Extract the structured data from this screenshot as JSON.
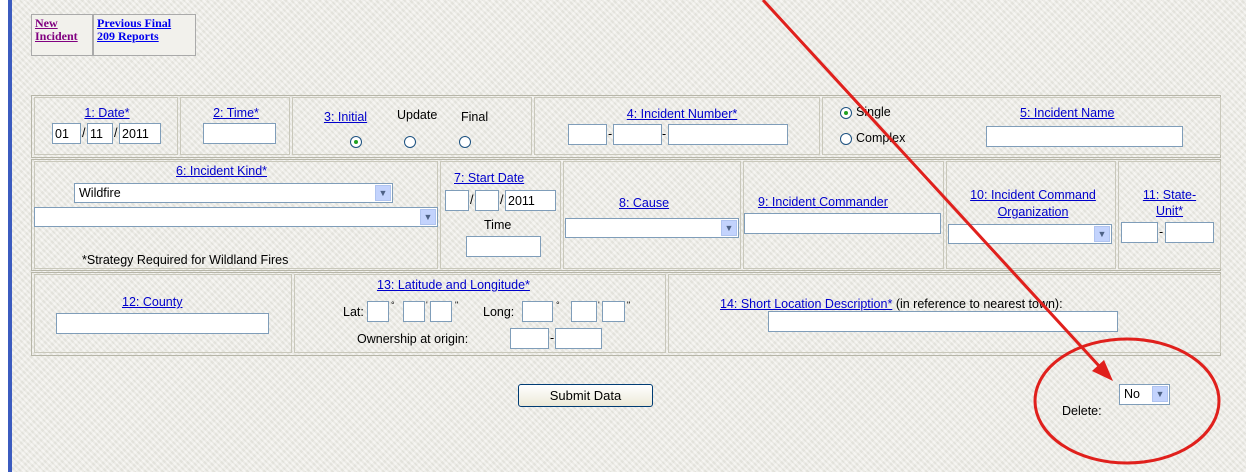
{
  "nav": {
    "new_incident": "New Incident",
    "previous_final": "Previous Final",
    "reports_209": "209 Reports"
  },
  "row1": {
    "date_label": "1: Date*",
    "date": {
      "month": "01",
      "day": "11",
      "year": "2011"
    },
    "time_label": "2: Time*",
    "time_value": "",
    "report_type_label": "3: Initial",
    "report_types": [
      "Update",
      "Final"
    ],
    "report_type_selected": "Initial",
    "incident_number_label": "4: Incident Number*",
    "incident_number_parts": [
      "",
      "",
      ""
    ],
    "single_label": "Single",
    "complex_label": "Complex",
    "single_complex_selected": "Single",
    "incident_name_label": "5: Incident Name",
    "incident_name_value": ""
  },
  "row2": {
    "incident_kind_label": "6: Incident Kind*",
    "incident_kind_value": "Wildfire",
    "strategy_value": "",
    "strategy_note": "*Strategy Required for Wildland Fires",
    "start_date_label": "7: Start Date",
    "start_date": {
      "month": "",
      "day": "",
      "year": "2011"
    },
    "time_label": "Time",
    "start_time_value": "",
    "cause_label": "8: Cause",
    "cause_value": "",
    "commander_label": "9: Incident Commander",
    "commander_value": "",
    "ico_label_line1": "10: Incident Command",
    "ico_label_line2": "Organization",
    "ico_value": "",
    "state_unit_label_line1": "11: State-",
    "state_unit_label_line2": "Unit*",
    "state_value": "",
    "unit_value": ""
  },
  "row3": {
    "county_label": "12: County",
    "county_value": "",
    "latlong_label": "13: Latitude and Longitude*",
    "lat_label": "Lat:",
    "long_label": "Long:",
    "deg_symbol": "°",
    "min_symbol": "'",
    "sec_symbol": "\"",
    "ownership_label": "Ownership at origin:",
    "location_label": "14: Short Location Description*",
    "location_note": "(in reference to nearest town):",
    "location_value": ""
  },
  "footer": {
    "submit_label": "Submit Data",
    "delete_label": "Delete:",
    "delete_value": "No"
  },
  "colors": {
    "link": "#0000cc",
    "annotation": "#e0201c",
    "background": "#ecebe4"
  },
  "icons": {
    "dropdown": "chevron-down-icon",
    "annotation_arrow": "arrow-icon",
    "annotation_circle": "ellipse-highlight"
  }
}
